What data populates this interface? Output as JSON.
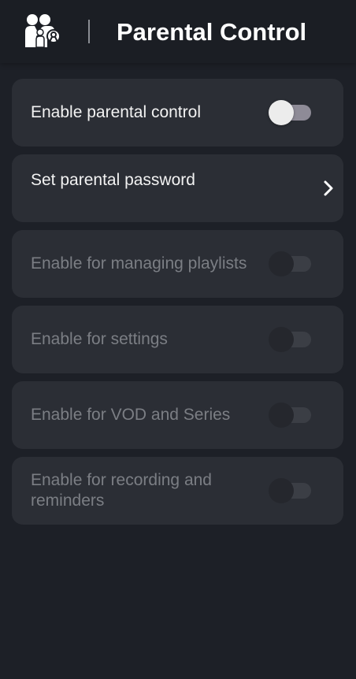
{
  "header": {
    "title": "Parental Control",
    "icon": "family-icon"
  },
  "settings": [
    {
      "label": "Enable parental control",
      "control": "toggle",
      "on": false,
      "enabled": true
    },
    {
      "label": "Set parental password",
      "control": "chevron-right-icon",
      "enabled": true
    },
    {
      "label": "Enable for managing playlists",
      "control": "toggle",
      "on": false,
      "enabled": false
    },
    {
      "label": "Enable for settings",
      "control": "toggle",
      "on": false,
      "enabled": false
    },
    {
      "label": "Enable for VOD and Series",
      "control": "toggle",
      "on": false,
      "enabled": false
    },
    {
      "label": "Enable for recording and reminders",
      "control": "toggle",
      "on": false,
      "enabled": false
    }
  ],
  "colors": {
    "background": "#1d2027",
    "header": "#1b1e24",
    "card": "#2b2e35",
    "text": "#f2f2f2",
    "disabled_text": "#7b7e84",
    "toggle_track_active": "#8e8b97",
    "toggle_knob_active": "#ececec"
  }
}
